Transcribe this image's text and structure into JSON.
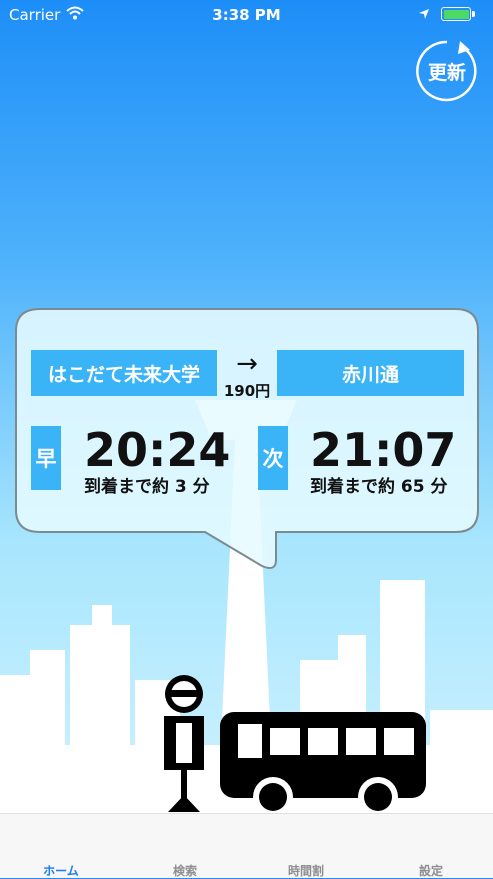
{
  "status_bar": {
    "carrier": "Carrier",
    "time": "3:38 PM"
  },
  "refresh_button": {
    "label": "更新"
  },
  "route": {
    "from": "はこだて未来大学",
    "arrow": "→",
    "to": "赤川通",
    "fare": "190円"
  },
  "departures": [
    {
      "badge": "早",
      "time": "20:24",
      "arrival": "到着まで約 3 分"
    },
    {
      "badge": "次",
      "time": "21:07",
      "arrival": "到着まで約 65 分"
    }
  ],
  "tabs": [
    {
      "label": "ホーム",
      "active": true
    },
    {
      "label": "検索",
      "active": false
    },
    {
      "label": "時間割",
      "active": false
    },
    {
      "label": "設定",
      "active": false
    }
  ],
  "colors": {
    "accent": "#3bb3f7",
    "active_tab": "#1a7cf5",
    "battery": "#4cd964"
  },
  "icons": [
    "wifi-icon",
    "location-icon",
    "battery-icon",
    "refresh-icon"
  ]
}
